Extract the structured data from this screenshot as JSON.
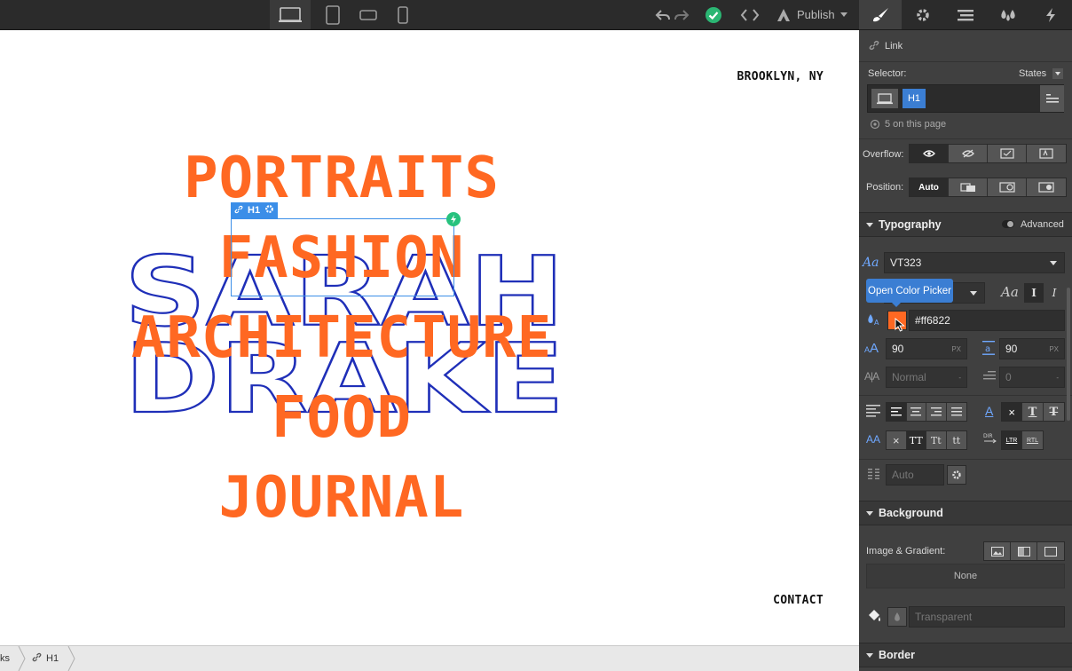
{
  "toolbar": {
    "publish_label": "Publish",
    "icons": [
      "desktop-icon",
      "tablet-icon",
      "mobile-landscape-icon",
      "mobile-portrait-icon",
      "undo-icon",
      "redo-icon",
      "check-icon",
      "code-icon",
      "publish-icon"
    ],
    "status_color": "#2bb673"
  },
  "panel_tabs": [
    "style-brush-icon",
    "settings-gear-icon",
    "navigator-icon",
    "symbols-drops-icon",
    "interactions-bolt-icon"
  ],
  "canvas": {
    "location": "BROOKLYN, NY",
    "contact": "CONTACT",
    "outline_title": [
      "SARAH",
      "DRAKE"
    ],
    "outline_color": "#1f2fb8",
    "menu": [
      "PORTRAITS",
      "FASHION",
      "ARCHITECTURE",
      "FOOD",
      "JOURNAL"
    ],
    "menu_color": "#ff6822",
    "selection": {
      "tag": "H1",
      "color": "#3b8ee8"
    }
  },
  "breadcrumb": {
    "body_label": "ks",
    "element_label": "H1"
  },
  "panel": {
    "link_label": "Link",
    "selector_label": "Selector:",
    "states_label": "States",
    "selector_tag": "H1",
    "on_page": "5 on this page",
    "overflow_label": "Overflow:",
    "position_label": "Position:",
    "position_auto": "Auto",
    "typography": {
      "title": "Typography",
      "advanced_label": "Advanced",
      "font": "VT323",
      "tooltip": "Open Color Picker",
      "color_hex": "#ff6822",
      "font_size": "90",
      "font_size_unit": "PX",
      "line_height": "90",
      "line_height_unit": "PX",
      "letter_spacing": "Normal",
      "letter_spacing_unit": "-",
      "text_indent": "0",
      "text_indent_unit": "-",
      "transform_tt": "TT",
      "transform_cap": "Tt",
      "transform_lower": "tt",
      "ltr": "LTR",
      "rtl": "RTL",
      "columns": "Auto"
    },
    "background": {
      "title": "Background",
      "image_gradient_label": "Image & Gradient:",
      "none_label": "None",
      "color_value": "Transparent"
    },
    "border": {
      "title": "Border"
    }
  }
}
